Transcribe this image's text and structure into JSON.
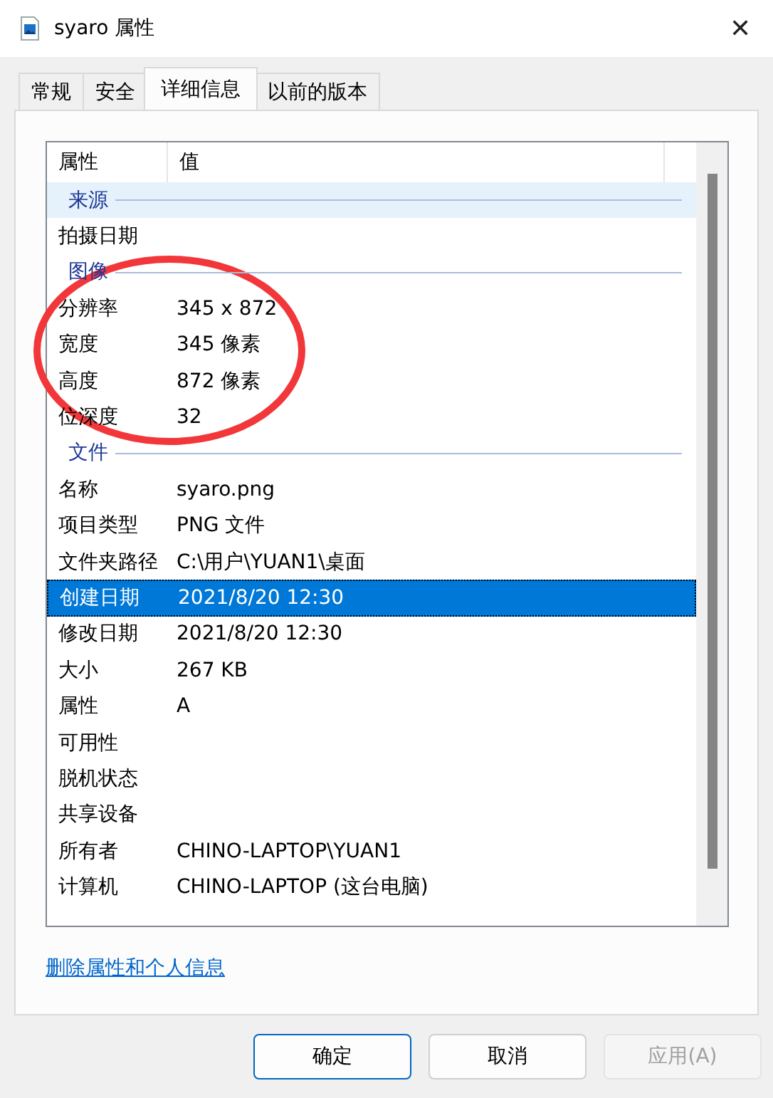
{
  "window": {
    "title": "syaro 属性",
    "close": "✕"
  },
  "tabs": [
    {
      "label": "常规",
      "selected": false
    },
    {
      "label": "安全",
      "selected": false
    },
    {
      "label": "详细信息",
      "selected": true
    },
    {
      "label": "以前的版本",
      "selected": false
    }
  ],
  "table": {
    "columns": [
      "属性",
      "值"
    ],
    "rows": [
      {
        "kind": "group",
        "label": "来源",
        "highlighted": true
      },
      {
        "kind": "property",
        "name": "拍摄日期",
        "value": "",
        "selected": false
      },
      {
        "kind": "group",
        "label": "图像",
        "highlighted": false
      },
      {
        "kind": "property",
        "name": "分辨率",
        "value": "345 x 872",
        "selected": false
      },
      {
        "kind": "property",
        "name": "宽度",
        "value": "345 像素",
        "selected": false
      },
      {
        "kind": "property",
        "name": "高度",
        "value": "872 像素",
        "selected": false
      },
      {
        "kind": "property",
        "name": "位深度",
        "value": "32",
        "selected": false
      },
      {
        "kind": "group",
        "label": "文件",
        "highlighted": false
      },
      {
        "kind": "property",
        "name": "名称",
        "value": "syaro.png",
        "selected": false
      },
      {
        "kind": "property",
        "name": "项目类型",
        "value": "PNG 文件",
        "selected": false
      },
      {
        "kind": "property",
        "name": "文件夹路径",
        "value": "C:\\用户\\YUAN1\\桌面",
        "selected": false
      },
      {
        "kind": "property",
        "name": "创建日期",
        "value": "2021/8/20 12:30",
        "selected": true
      },
      {
        "kind": "property",
        "name": "修改日期",
        "value": "2021/8/20 12:30",
        "selected": false
      },
      {
        "kind": "property",
        "name": "大小",
        "value": "267 KB",
        "selected": false
      },
      {
        "kind": "property",
        "name": "属性",
        "value": "A",
        "selected": false
      },
      {
        "kind": "property",
        "name": "可用性",
        "value": "",
        "selected": false
      },
      {
        "kind": "property",
        "name": "脱机状态",
        "value": "",
        "selected": false
      },
      {
        "kind": "property",
        "name": "共享设备",
        "value": "",
        "selected": false
      },
      {
        "kind": "property",
        "name": "所有者",
        "value": "CHINO-LAPTOP\\YUAN1",
        "selected": false
      },
      {
        "kind": "property",
        "name": "计算机",
        "value": "CHINO-LAPTOP (这台电脑)",
        "selected": false
      }
    ]
  },
  "link": "删除属性和个人信息",
  "buttons": [
    {
      "label": "确定",
      "default": true,
      "disabled": false
    },
    {
      "label": "取消",
      "default": false,
      "disabled": false
    },
    {
      "label": "应用(A)",
      "default": false,
      "disabled": true
    }
  ]
}
